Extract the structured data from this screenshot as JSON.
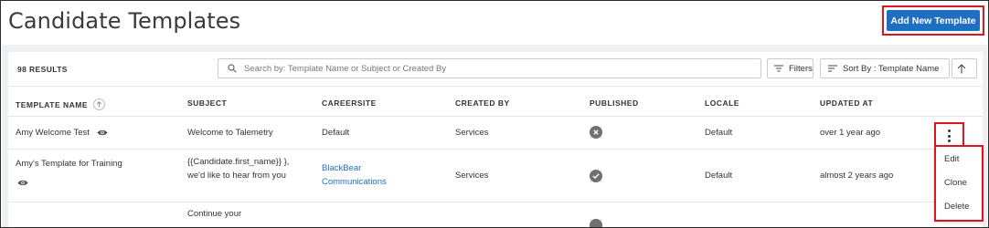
{
  "header": {
    "title": "Candidate Templates",
    "add_button": "Add New Template"
  },
  "toolbar": {
    "results": "98 RESULTS",
    "search_placeholder": "Search by: Template Name or Subject or Created By",
    "filters": "Filters",
    "sort": "Sort By : Template Name"
  },
  "table": {
    "columns": [
      "TEMPLATE NAME",
      "SUBJECT",
      "CAREERSITE",
      "CREATED BY",
      "PUBLISHED",
      "LOCALE",
      "UPDATED AT"
    ],
    "rows": [
      {
        "name": "Amy Welcome Test",
        "subject": "Welcome to Talemetry",
        "careersite": "Default",
        "created_by": "Services",
        "published": "no",
        "locale": "Default",
        "updated_at": "over 1 year ago"
      },
      {
        "name": "Amy's Template for Training",
        "subject": "{{Candidate.first_name}} }, we'd like to hear from you",
        "careersite": "BlackBear Communications",
        "created_by": "Services",
        "published": "yes",
        "locale": "Default",
        "updated_at": "almost 2 years ago"
      },
      {
        "name": "",
        "subject": "Continue your",
        "careersite": "",
        "created_by": "",
        "published": "",
        "locale": "",
        "updated_at": ""
      }
    ]
  },
  "row_menu": {
    "items": [
      "Edit",
      "Clone",
      "Delete"
    ]
  },
  "colors": {
    "primary": "#1e6fc1",
    "highlight": "#e0141e"
  }
}
